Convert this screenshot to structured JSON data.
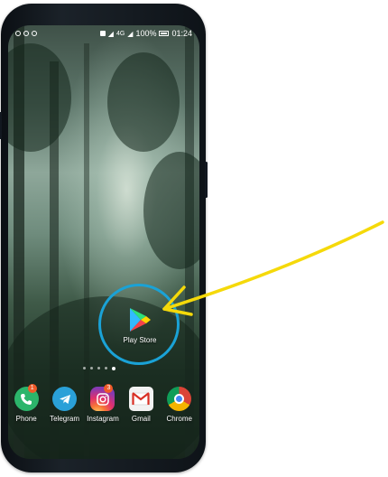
{
  "status_bar": {
    "battery": "100%",
    "time": "01:24",
    "battery_icon": "battery-icon",
    "network": "4G"
  },
  "featured_app": {
    "label": "Play Store",
    "icon": "play-store-icon"
  },
  "home_pages": {
    "count": 5,
    "active_index": 4
  },
  "dock": [
    {
      "label": "Phone",
      "icon": "phone-icon",
      "badge": "1"
    },
    {
      "label": "Telegram",
      "icon": "telegram-icon",
      "badge": ""
    },
    {
      "label": "Instagram",
      "icon": "instagram-icon",
      "badge": "3"
    },
    {
      "label": "Gmail",
      "icon": "gmail-icon",
      "badge": ""
    },
    {
      "label": "Chrome",
      "icon": "chrome-icon",
      "badge": ""
    }
  ],
  "colors": {
    "highlight_ring": "#1aa2d6",
    "arrow": "#f5d90a",
    "badge": "#f05a28"
  }
}
